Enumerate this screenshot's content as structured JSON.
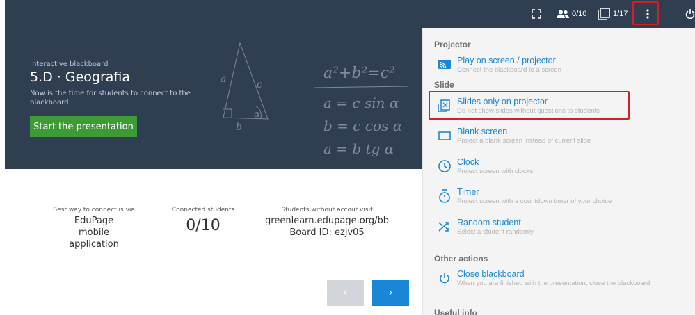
{
  "topbar": {
    "students_count": "0/10",
    "slides_count": "1/17"
  },
  "hero": {
    "eyebrow": "Interactive blackboard",
    "title": "5.D · Geografia",
    "subtitle": "Now is the time for students to connect to the blackboard.",
    "start_label": "Start the presentation",
    "chalk": {
      "side_a": "a",
      "side_b": "b",
      "side_c": "c",
      "angle": "α",
      "eq1": "a²+b²=c²",
      "eq2": "a = c sin α",
      "eq3": "b = c cos α",
      "eq4": "a = b tg α"
    }
  },
  "info": {
    "connect_caption": "Best way to connect is via",
    "connect_value": "EduPage mobile application",
    "students_caption": "Connected students",
    "students_value": "0/10",
    "visit_caption": "Students without accout visit",
    "visit_url": "greenlearn.edupage.org/bb",
    "board_id": "Board ID: ezjv05"
  },
  "nav": {
    "prev": "‹",
    "next": "›"
  },
  "menu": {
    "projector_heading": "Projector",
    "slide_heading": "Slide",
    "other_heading": "Other actions",
    "partial_heading": "Useful info",
    "items": [
      {
        "label": "Play on screen / projector",
        "desc": "Connect the blackboard to a screen",
        "icon": "cast-icon"
      },
      {
        "label": "Slides only on projector",
        "desc": "Do not show slides without questions to students",
        "icon": "slides-only-icon"
      },
      {
        "label": "Blank screen",
        "desc": "Project a blank screen instead of current slide",
        "icon": "blank-screen-icon"
      },
      {
        "label": "Clock",
        "desc": "Project screen with clocks",
        "icon": "clock-icon"
      },
      {
        "label": "Timer",
        "desc": "Project screen with a countdown timer of your choice",
        "icon": "timer-icon"
      },
      {
        "label": "Random student",
        "desc": "Select a student randomly",
        "icon": "shuffle-icon"
      },
      {
        "label": "Close blackboard",
        "desc": "When you are finished with the presentation, close the blackboard",
        "icon": "power-icon"
      }
    ]
  },
  "colors": {
    "dark": "#2f3e50",
    "accent": "#1a86d8",
    "green": "#3d9b35",
    "highlight": "#d12027"
  }
}
